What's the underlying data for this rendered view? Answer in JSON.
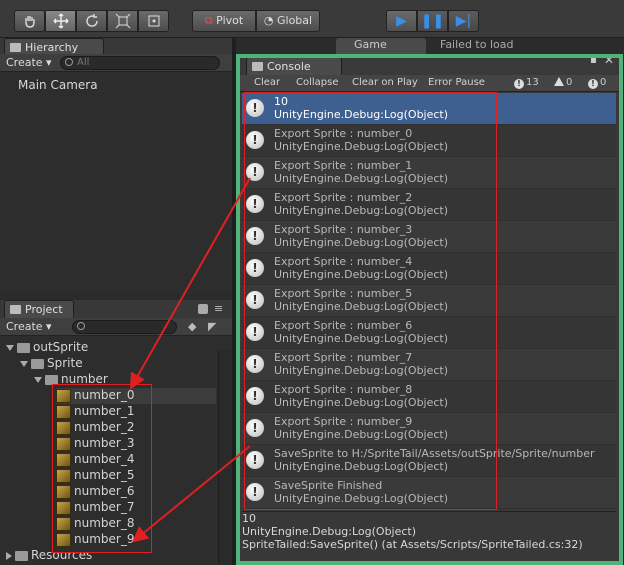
{
  "toolbar": {
    "tools": [
      "hand-icon",
      "move-icon",
      "rotate-icon",
      "scale-icon",
      "rect-icon"
    ],
    "pivot_label": "Pivot",
    "global_label": "Global"
  },
  "hierarchy": {
    "tab_label": "Hierarchy",
    "create_label": "Create",
    "search_placeholder": "All",
    "items": [
      "Main Camera"
    ]
  },
  "background_tabs": {
    "game_tab": "Game",
    "status": "Failed to load"
  },
  "project": {
    "tab_label": "Project",
    "create_label": "Create",
    "tree": {
      "root": "outSprite",
      "child": "Sprite",
      "folder": "number",
      "files": [
        "number_0",
        "number_1",
        "number_2",
        "number_3",
        "number_4",
        "number_5",
        "number_6",
        "number_7",
        "number_8",
        "number_9"
      ],
      "next_root": "Resources"
    }
  },
  "console": {
    "tab_label": "Console",
    "buttons": [
      "Clear",
      "Collapse",
      "Clear on Play",
      "Error Pause"
    ],
    "counts": {
      "log": "13",
      "warn": "0",
      "error": "0"
    },
    "logs": [
      {
        "line1": "10",
        "line2": "UnityEngine.Debug:Log(Object)"
      },
      {
        "line1": "Export Sprite : number_0",
        "line2": "UnityEngine.Debug:Log(Object)"
      },
      {
        "line1": "Export Sprite : number_1",
        "line2": "UnityEngine.Debug:Log(Object)"
      },
      {
        "line1": "Export Sprite : number_2",
        "line2": "UnityEngine.Debug:Log(Object)"
      },
      {
        "line1": "Export Sprite : number_3",
        "line2": "UnityEngine.Debug:Log(Object)"
      },
      {
        "line1": "Export Sprite : number_4",
        "line2": "UnityEngine.Debug:Log(Object)"
      },
      {
        "line1": "Export Sprite : number_5",
        "line2": "UnityEngine.Debug:Log(Object)"
      },
      {
        "line1": "Export Sprite : number_6",
        "line2": "UnityEngine.Debug:Log(Object)"
      },
      {
        "line1": "Export Sprite : number_7",
        "line2": "UnityEngine.Debug:Log(Object)"
      },
      {
        "line1": "Export Sprite : number_8",
        "line2": "UnityEngine.Debug:Log(Object)"
      },
      {
        "line1": "Export Sprite : number_9",
        "line2": "UnityEngine.Debug:Log(Object)"
      },
      {
        "line1": "SaveSprite to H:/SpriteTail/Assets/outSprite/Sprite/number",
        "line2": "UnityEngine.Debug:Log(Object)"
      },
      {
        "line1": "SaveSprite Finished",
        "line2": "UnityEngine.Debug:Log(Object)"
      }
    ],
    "detail": [
      "10",
      "UnityEngine.Debug:Log(Object)",
      "SpriteTailed:SaveSprite() (at Assets/Scripts/SpriteTailed.cs:32)"
    ]
  },
  "colors": {
    "highlight_frame": "#4fb37a",
    "annotation": "#e02020",
    "selected_row": "#3d6090"
  }
}
